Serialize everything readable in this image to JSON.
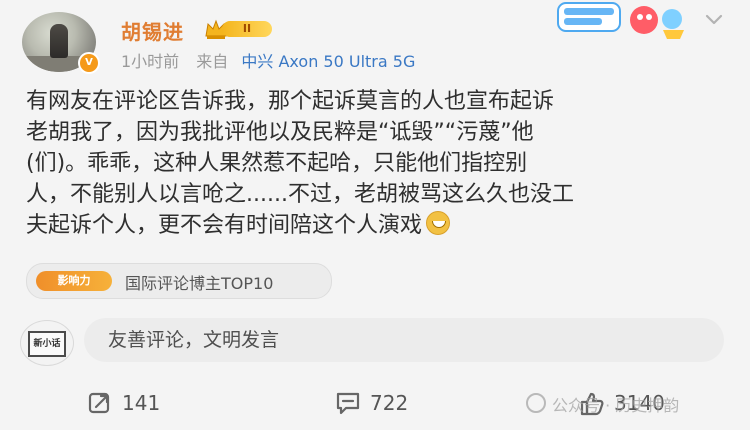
{
  "post": {
    "username": "胡锡进",
    "vip_level": "II",
    "verified_badge": "V",
    "time": "1小时前",
    "source_prefix": "来自",
    "device": "中兴 Axon 50 Ultra 5G",
    "content_lines": [
      "有网友在评论区告诉我，那个起诉莫言的人也宣布起诉",
      "老胡我了，因为我批评他以及民粹是“诋毁”“污蔑”他",
      "(们)。乖乖，这种人果然惹不起哈，只能他们指控别",
      "人，不能别人以言呛之......不过，老胡被骂这么久也没工",
      "夫起诉个人，更不会有时间陪这个人演戏"
    ],
    "emoji": "grin-emoji",
    "influence_label": "影响力",
    "influence_text": "国际评论博主TOP10",
    "comment_placeholder": "友善评论，文明发言",
    "comment_avatar_text": "新小话",
    "actions": {
      "forward_count": "141",
      "comment_count": "722",
      "like_count": "3140"
    },
    "watermark": "公众号 · 历史押韵"
  },
  "colors": {
    "username": "#e07d32",
    "device": "#3a78c4",
    "background": "#f4f4f4",
    "vip": "#f4b51e"
  },
  "icons": {
    "chevron": "chevron-down-icon",
    "forward": "forward-icon",
    "comment": "comment-icon",
    "like": "like-icon"
  }
}
